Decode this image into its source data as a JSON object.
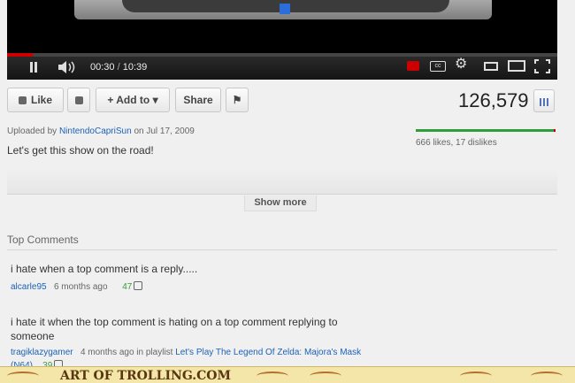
{
  "player": {
    "current_time": "00:30",
    "separator": "/",
    "duration": "10:39",
    "progress": 0.047,
    "icons": [
      "pause-icon",
      "volume-icon",
      "annotations-icon",
      "cc-icon",
      "gear-icon",
      "small-player-icon",
      "large-player-icon",
      "fullscreen-icon"
    ],
    "accent": "#cc0000"
  },
  "actions": {
    "like_label": "Like",
    "add_to_label": "+ Add to",
    "share_label": "Share",
    "view_count": "126,579"
  },
  "upload": {
    "prefix": "Uploaded by",
    "uploader": "NintendoCapriSun",
    "date_prefix": "on",
    "date": "Jul 17, 2009",
    "description": "Let's get this show on the road!"
  },
  "ratings": {
    "text": "666 likes, 17 dislikes",
    "like_color": "#2f9d3b",
    "dislike_color": "#cc0000"
  },
  "show_more_label": "Show more",
  "comments": {
    "heading": "Top Comments",
    "items": [
      {
        "text": "i hate when a top comment is a reply.....",
        "user": "alcarle95",
        "time": "6 months ago",
        "votes": "47"
      },
      {
        "text": "i hate it when the top comment is hating on a top comment replying to someone",
        "user": "tragiklazygamer",
        "time": "4 months ago in playlist",
        "playlist": "Let's Play The Legend Of Zelda: Majora's Mask",
        "playlist_suffix": "(N64)",
        "votes": "39"
      }
    ]
  },
  "footer": {
    "text": "ART OF TROLLING.COM"
  }
}
